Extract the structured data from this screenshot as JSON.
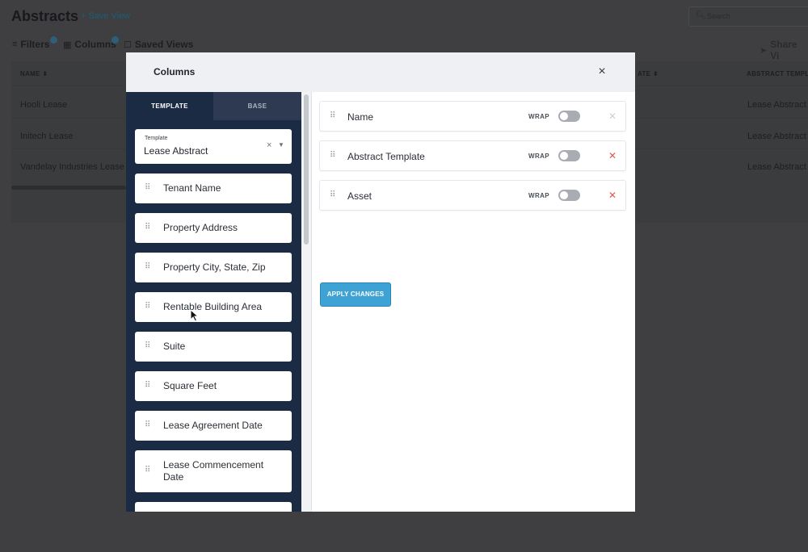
{
  "background": {
    "title": "Abstracts",
    "save_view": "+ Save View",
    "search_placeholder": "Search",
    "toolbar": {
      "filters": "Filters",
      "columns": "Columns",
      "saved_views": "Saved Views",
      "share": "Share Vi"
    },
    "table": {
      "headers": [
        "NAME ⬍",
        "ATE ⬍",
        "ABSTRACT TEMPLA"
      ],
      "rows": [
        {
          "name": "Hooli Lease",
          "template": "Lease Abstract"
        },
        {
          "name": "Initech Lease",
          "template": "Lease Abstract"
        },
        {
          "name": "Vandelay Industries Lease",
          "template": "Lease Abstract"
        }
      ]
    }
  },
  "modal": {
    "title": "Columns",
    "close_icon": "×",
    "tabs": [
      {
        "label": "TEMPLATE",
        "active": true
      },
      {
        "label": "BASE",
        "active": false
      }
    ],
    "template_select": {
      "label": "Template",
      "value": "Lease Abstract",
      "clear_icon": "×",
      "caret_icon": "▼"
    },
    "available_fields": [
      "Tenant Name",
      "Property Address",
      "Property City, State, Zip",
      "Rentable Building Area",
      "Suite",
      "Square Feet",
      "Lease Agreement Date",
      "Lease Commencement Date"
    ],
    "selected_columns": [
      {
        "name": "Name",
        "wrap_label": "WRAP",
        "wrap": false,
        "removable": false
      },
      {
        "name": "Abstract Template",
        "wrap_label": "WRAP",
        "wrap": false,
        "removable": true
      },
      {
        "name": "Asset",
        "wrap_label": "WRAP",
        "wrap": false,
        "removable": true
      }
    ],
    "remove_icon": "✕",
    "grip_icon": "⠿",
    "apply_label": "APPLY CHANGES"
  },
  "colors": {
    "left_panel_bg": "#1c2b44",
    "apply_button_bg": "#3ea3d4",
    "remove_active": "#e0584c",
    "overlay_bg": "#3f3f41"
  }
}
